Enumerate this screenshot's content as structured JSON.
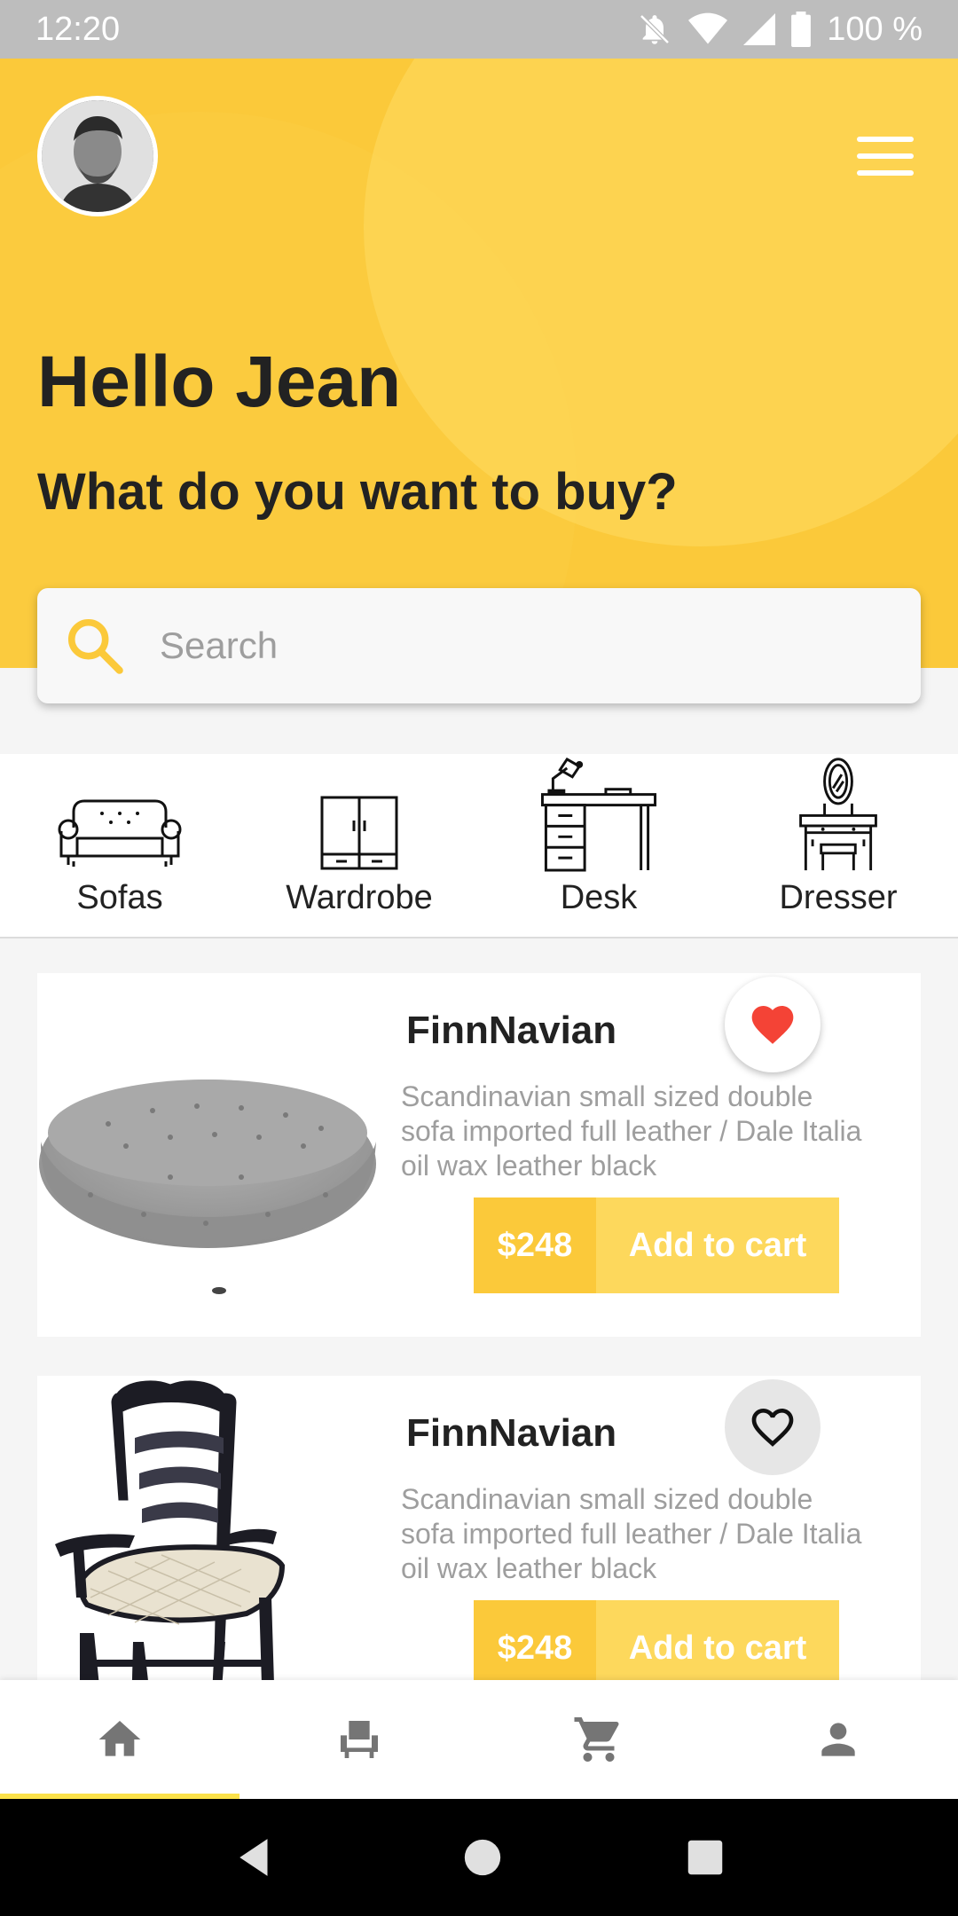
{
  "status_bar": {
    "time": "12:20",
    "battery": "100 %",
    "icons": [
      "mute-icon",
      "wifi-icon",
      "signal-icon",
      "battery-icon"
    ]
  },
  "header": {
    "greeting": "Hello Jean",
    "subtitle": "What do you want to buy?",
    "avatar": "avatar",
    "menu_icon": "menu-icon"
  },
  "search": {
    "placeholder": "Search",
    "icon": "search-icon"
  },
  "categories": [
    {
      "label": "Sofas",
      "icon": "sofa-icon"
    },
    {
      "label": "Wardrobe",
      "icon": "wardrobe-icon"
    },
    {
      "label": "Desk",
      "icon": "desk-icon"
    },
    {
      "label": "Dresser",
      "icon": "dresser-icon"
    }
  ],
  "products": [
    {
      "name": "FinnNavian",
      "description": "Scandinavian small sized double sofa imported full leather / Dale Italia oil wax leather black",
      "price": "$248",
      "cart_label": "Add to cart",
      "favorite": true,
      "image": "ottoman-image"
    },
    {
      "name": "FinnNavian",
      "description": "Scandinavian small sized double sofa imported full leather / Dale Italia oil wax leather black",
      "price": "$248",
      "cart_label": "Add to cart",
      "favorite": false,
      "image": "chair-image"
    }
  ],
  "bottom_nav": [
    {
      "icon": "home-icon",
      "active": true
    },
    {
      "icon": "chair-icon",
      "active": false
    },
    {
      "icon": "cart-icon",
      "active": false
    },
    {
      "icon": "profile-icon",
      "active": false
    }
  ],
  "colors": {
    "accent": "#fbc93a",
    "accent_light": "#fdd85c",
    "heart": "#f44336",
    "nav_indicator": "#fbe14a"
  }
}
